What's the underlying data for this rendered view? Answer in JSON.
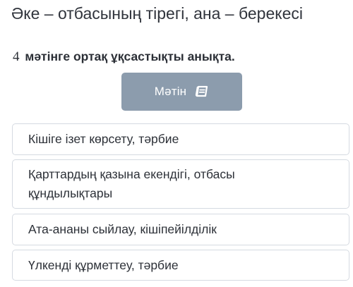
{
  "header": {
    "title": "Әке – отбасының тірегі, ана – берекесі"
  },
  "question": {
    "number": "4",
    "text": "мәтінге ортақ ұқсастықты анықта."
  },
  "text_button": {
    "label": "Мәтін",
    "icon": "book-icon",
    "color": "#8c9cad"
  },
  "options": [
    {
      "label": "Кішіге ізет көрсету, тәрбие"
    },
    {
      "label": "Қарттардың қазына екендігі, отбасы құндылықтары"
    },
    {
      "label": "Ата-ананы сыйлау, кішіпейілділік"
    },
    {
      "label": "Үлкенді құрметтеу, тәрбие"
    }
  ]
}
